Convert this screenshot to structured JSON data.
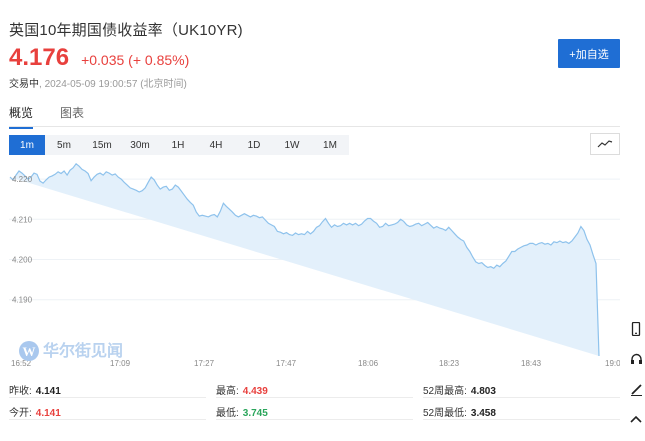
{
  "quote": {
    "title": "英国10年期国债收益率（UK10YR)",
    "price": "4.176",
    "change": "+0.035 (+ 0.85%)",
    "status": "交易中",
    "time": "2024-05-09 19:00:57 (北京时间)"
  },
  "add_button": "+加自选",
  "tabs": [
    "概览",
    "图表"
  ],
  "periods": [
    "1m",
    "5m",
    "15m",
    "30m",
    "1H",
    "4H",
    "1D",
    "1W",
    "1M"
  ],
  "watermark": "华尔街见闻",
  "chart_data": {
    "type": "area",
    "y_ticks": [
      "4.220",
      "4.210",
      "4.200",
      "4.190"
    ],
    "x_ticks": [
      "16:52",
      "17:09",
      "17:27",
      "17:47",
      "18:06",
      "18:23",
      "18:43",
      "19:0"
    ],
    "ylim": [
      4.176,
      4.224
    ],
    "x": [
      0,
      3,
      6,
      9,
      12,
      15,
      18,
      21,
      24,
      27,
      30,
      33,
      36,
      39,
      42,
      45,
      48,
      51,
      54,
      57,
      60,
      63,
      66,
      69,
      72,
      75,
      78,
      81,
      84,
      87,
      90,
      93,
      96,
      99,
      102,
      105,
      108,
      111,
      114,
      117,
      120,
      123,
      126,
      129,
      132,
      135,
      138,
      141,
      144,
      147,
      150,
      153,
      156,
      159,
      162,
      165,
      168,
      171,
      174,
      177,
      180,
      183,
      186,
      189,
      192,
      195,
      198,
      201,
      204,
      207,
      210,
      213,
      216,
      219,
      222,
      225,
      228,
      231,
      234,
      237,
      240,
      243,
      246,
      249,
      252,
      255,
      258,
      261,
      264,
      267,
      270,
      273,
      276,
      279,
      282,
      285,
      288,
      291,
      294,
      297,
      300,
      303,
      306,
      309,
      312,
      315,
      318,
      321,
      324,
      327,
      330,
      333,
      336,
      339,
      342,
      345,
      348,
      351,
      354,
      357,
      360,
      363,
      366,
      369,
      372,
      375,
      378,
      381,
      384,
      387,
      390,
      393,
      396,
      399,
      402,
      405,
      408,
      411,
      414,
      417,
      420,
      423,
      426,
      429,
      432,
      435,
      438,
      441,
      444,
      447,
      450,
      453,
      456,
      459,
      462,
      465,
      468,
      471,
      474,
      477,
      480,
      483,
      486,
      489,
      492,
      495,
      498,
      501,
      504,
      507,
      510,
      513,
      516,
      519,
      522,
      525,
      528,
      531,
      534,
      537,
      540,
      543,
      546,
      549,
      552,
      555,
      558,
      561,
      564,
      567,
      570,
      573,
      576,
      579,
      582,
      585,
      588,
      591,
      594,
      597,
      600,
      603,
      606
    ],
    "values": [
      4.2205,
      4.2198,
      4.221,
      4.222,
      4.2215,
      4.2208,
      4.22,
      4.2205,
      4.2215,
      4.2212,
      4.2195,
      4.219,
      4.2198,
      4.2205,
      4.2208,
      4.2212,
      4.2218,
      4.2214,
      4.222,
      4.221,
      4.2222,
      4.2228,
      4.2238,
      4.2232,
      4.2224,
      4.222,
      4.2214,
      4.2196,
      4.2205,
      4.2212,
      4.2215,
      4.221,
      4.2218,
      4.2215,
      4.221,
      4.2213,
      4.2205,
      4.22,
      4.2192,
      4.2185,
      4.2178,
      4.2175,
      4.2172,
      4.2168,
      4.2171,
      4.2178,
      4.2192,
      4.2205,
      4.2198,
      4.2185,
      4.2175,
      4.218,
      4.2182,
      4.2172,
      4.2175,
      4.2185,
      4.218,
      4.217,
      4.216,
      4.215,
      4.2142,
      4.2135,
      4.2118,
      4.2108,
      4.211,
      4.2108,
      4.2106,
      4.211,
      4.2112,
      4.2106,
      4.212,
      4.214,
      4.2132,
      4.2125,
      4.2118,
      4.211,
      4.2106,
      4.211,
      4.2114,
      4.211,
      4.2106,
      4.211,
      4.2108,
      4.2104,
      4.2106,
      4.2098,
      4.209,
      4.2086,
      4.2082,
      4.207,
      4.2068,
      4.2064,
      4.2067,
      4.2062,
      4.206,
      4.2066,
      4.2062,
      4.2064,
      4.2062,
      4.207,
      4.2064,
      4.207,
      4.208,
      4.2084,
      4.2094,
      4.2102,
      4.209,
      4.208,
      4.2086,
      4.2082,
      4.2084,
      4.209,
      4.2086,
      4.209,
      4.2086,
      4.209,
      4.2084,
      4.2088,
      4.2096,
      4.2102,
      4.2102,
      4.2095,
      4.209,
      4.208,
      4.2082,
      4.209,
      4.2084,
      4.2086,
      4.2088,
      4.2092,
      4.21,
      4.2095,
      4.2086,
      4.2082,
      4.2084,
      4.2088,
      4.209,
      4.2084,
      4.2088,
      4.2092,
      4.2085,
      4.2078,
      4.2082,
      4.2078,
      4.2076,
      4.2072,
      4.208,
      4.2072,
      4.2064,
      4.2056,
      4.205,
      4.2046,
      4.203,
      4.202,
      4.2006,
      4.1994,
      4.199,
      4.1992,
      4.1985,
      4.198,
      4.1982,
      4.1978,
      4.1986,
      4.1982,
      4.199,
      4.1996,
      4.2008,
      4.202,
      4.202,
      4.2026,
      4.203,
      4.2034,
      4.2036,
      4.204,
      4.204,
      4.2036,
      4.204,
      4.2042,
      4.2038,
      4.204,
      4.2036,
      4.2044,
      4.2042,
      4.2046,
      4.2042,
      4.2044,
      4.204,
      4.2046,
      4.2056,
      4.2066,
      4.2082,
      4.2072,
      4.205,
      4.2036,
      4.2012,
      4.199,
      4.176
    ]
  },
  "stats": [
    [
      {
        "label": "昨收:",
        "value": "4.141",
        "color": "#222222"
      },
      {
        "label": "最高:",
        "value": "4.439",
        "color": "#e8403d"
      },
      {
        "label": "52周最高:",
        "value": "4.803",
        "color": "#222222"
      }
    ],
    [
      {
        "label": "今开:",
        "value": "4.141",
        "color": "#e8403d"
      },
      {
        "label": "最低:",
        "value": "3.745",
        "color": "#2aa55b"
      },
      {
        "label": "52周最低:",
        "value": "3.458",
        "color": "#222222"
      }
    ]
  ],
  "colors": {
    "accent": "#1f6ed4",
    "up": "#e8403d",
    "down": "#2aa55b",
    "line": "#8ec2ec",
    "fill": "#e3f0fb"
  },
  "rail_icons": [
    "phone-icon",
    "headset-icon",
    "pen-icon",
    "chevron-up-icon"
  ]
}
